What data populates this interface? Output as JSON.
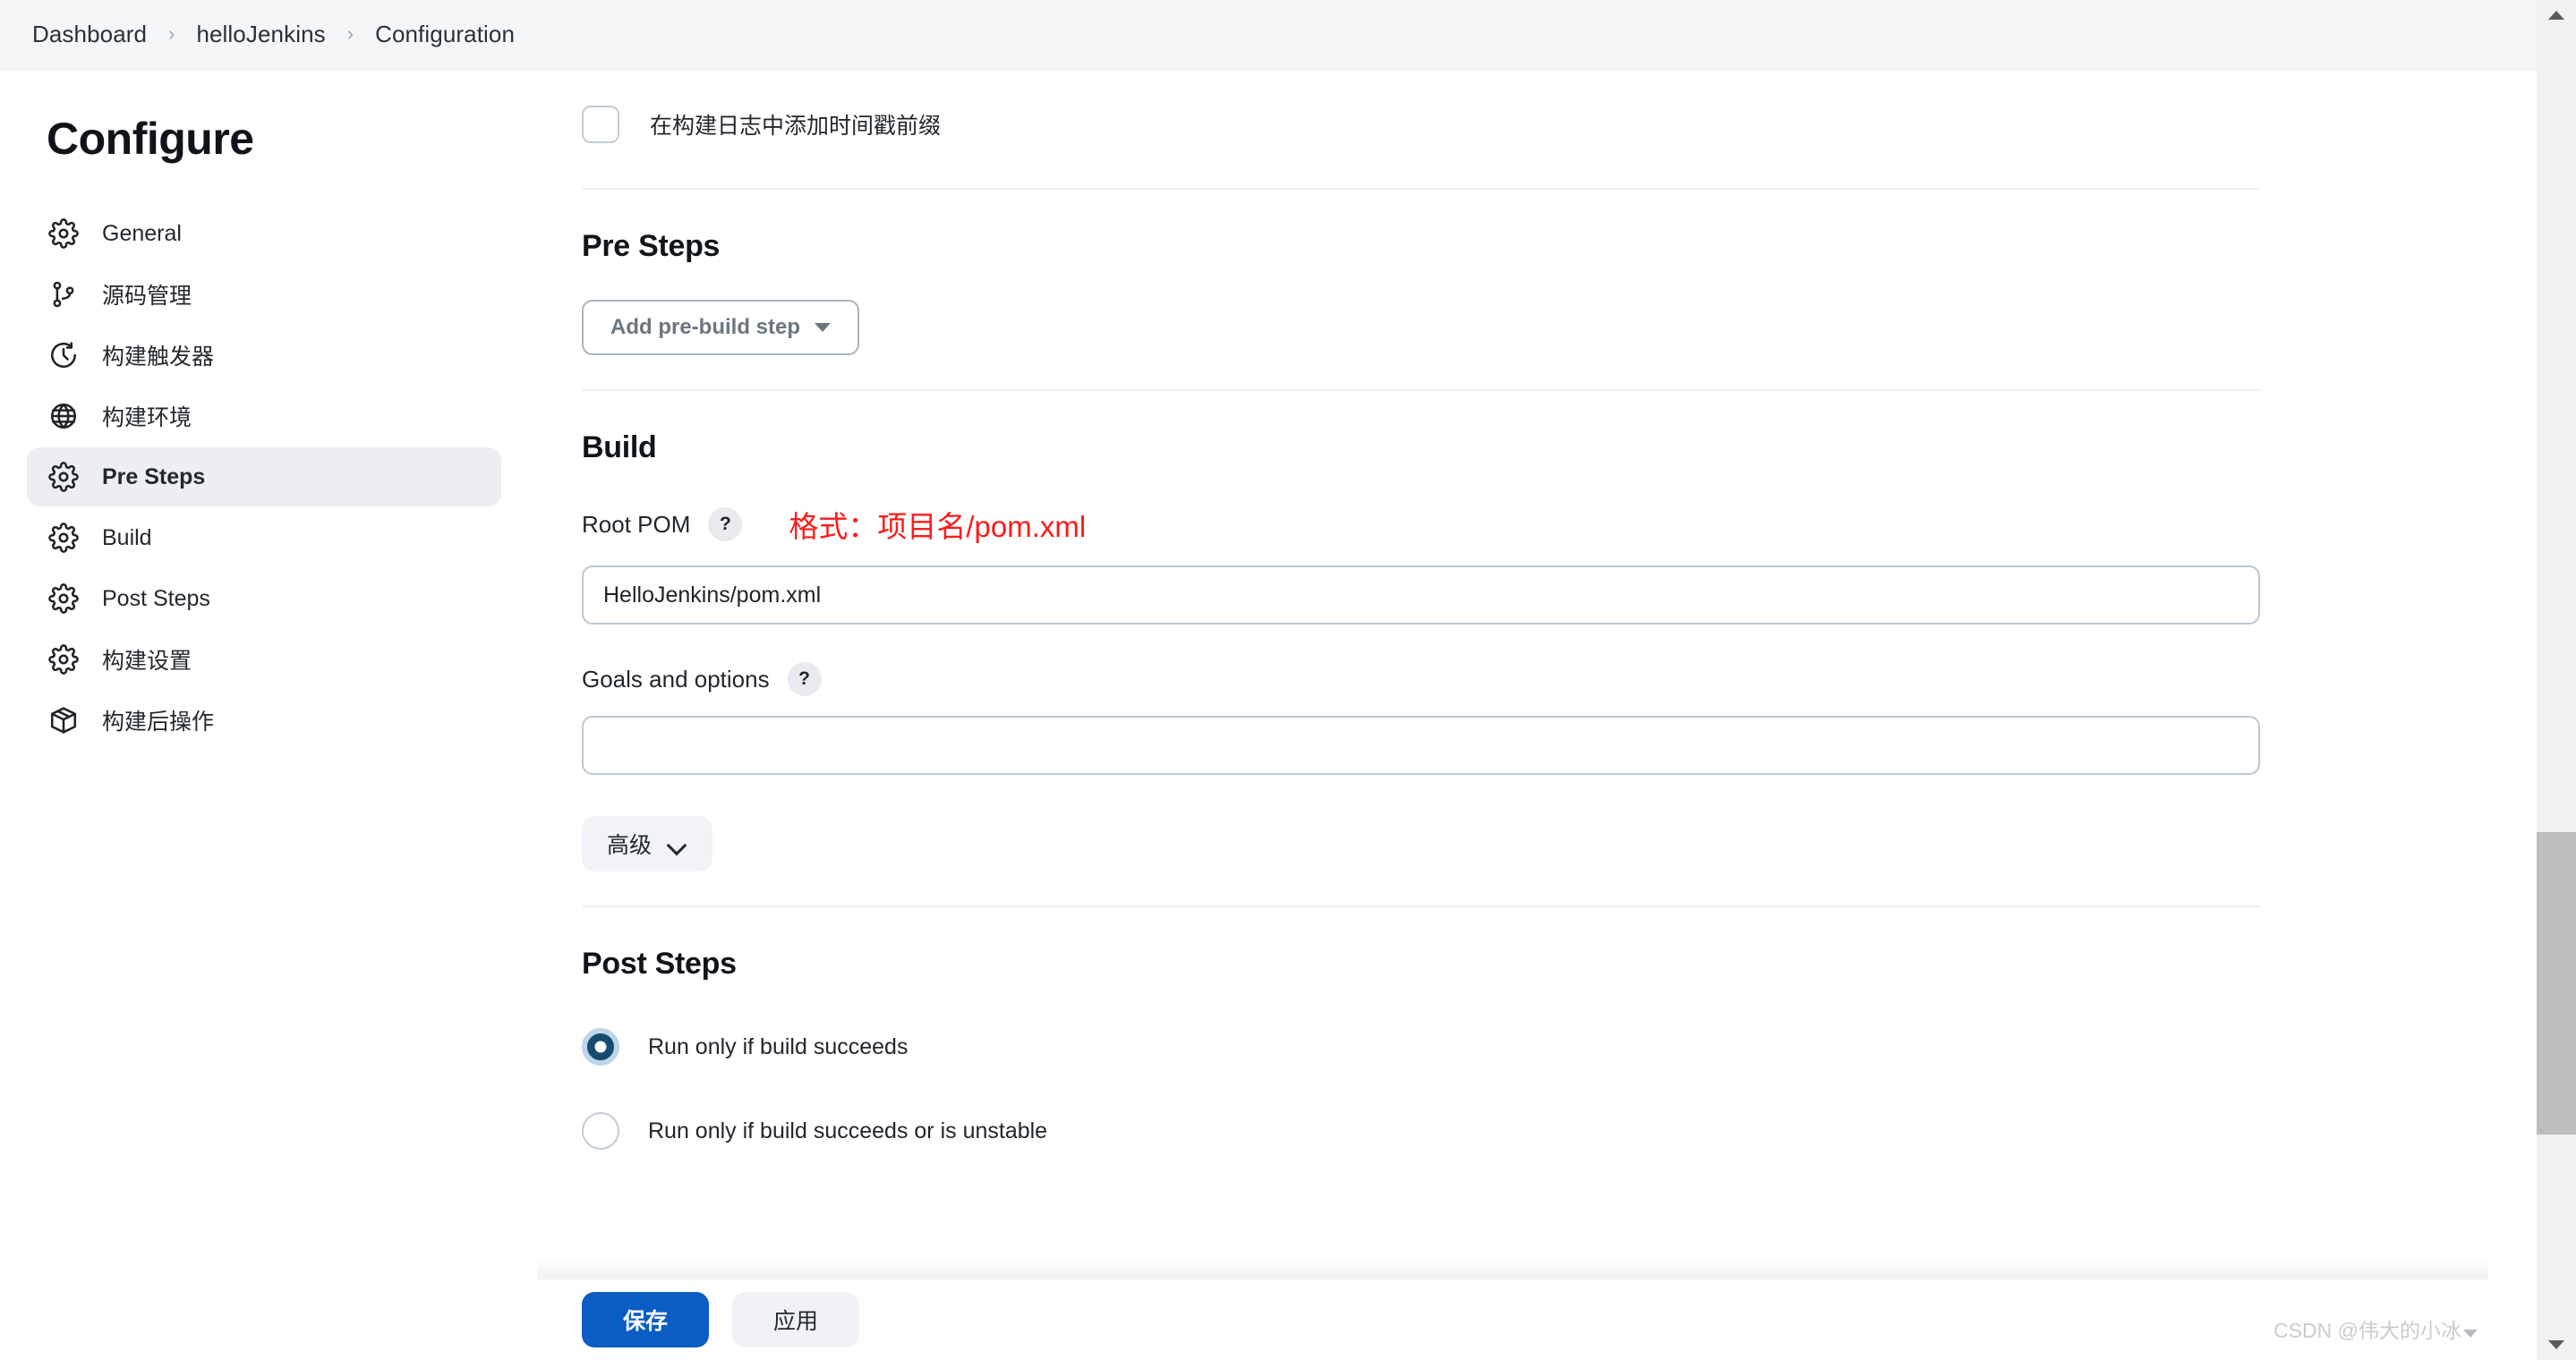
{
  "breadcrumb": {
    "items": [
      "Dashboard",
      "helloJenkins",
      "Configuration"
    ],
    "separator": "›"
  },
  "sidebar": {
    "title": "Configure",
    "items": [
      {
        "label": "General",
        "icon": "gear-icon",
        "active": false
      },
      {
        "label": "源码管理",
        "icon": "git-branch-icon",
        "active": false
      },
      {
        "label": "构建触发器",
        "icon": "clock-icon",
        "active": false
      },
      {
        "label": "构建环境",
        "icon": "globe-icon",
        "active": false
      },
      {
        "label": "Pre Steps",
        "icon": "gear-icon",
        "active": true
      },
      {
        "label": "Build",
        "icon": "gear-icon",
        "active": false
      },
      {
        "label": "Post Steps",
        "icon": "gear-icon",
        "active": false
      },
      {
        "label": "构建设置",
        "icon": "gear-icon",
        "active": false
      },
      {
        "label": "构建后操作",
        "icon": "package-icon",
        "active": false
      }
    ]
  },
  "main": {
    "timestamp_checkbox": {
      "label": "在构建日志中添加时间戳前缀",
      "checked": false
    },
    "pre_steps": {
      "title": "Pre Steps",
      "add_button": "Add pre-build step"
    },
    "build": {
      "title": "Build",
      "root_pom": {
        "label": "Root POM",
        "help": "?",
        "annotation": "格式：项目名/pom.xml",
        "value": "HelloJenkins/pom.xml"
      },
      "goals": {
        "label": "Goals and options",
        "help": "?",
        "value": ""
      },
      "advanced_button": "高级"
    },
    "post_steps": {
      "title": "Post Steps",
      "options": [
        {
          "label": "Run only if build succeeds",
          "selected": true
        },
        {
          "label": "Run only if build succeeds or is unstable",
          "selected": false
        }
      ]
    }
  },
  "footer": {
    "save_label": "保存",
    "apply_label": "应用"
  },
  "watermark": "CSDN @伟大的小冰",
  "colors": {
    "primary": "#0b5cc4",
    "annotation": "#ff1a1a",
    "radio_selected": "#154c6e",
    "active_nav_bg": "#eceef2"
  }
}
